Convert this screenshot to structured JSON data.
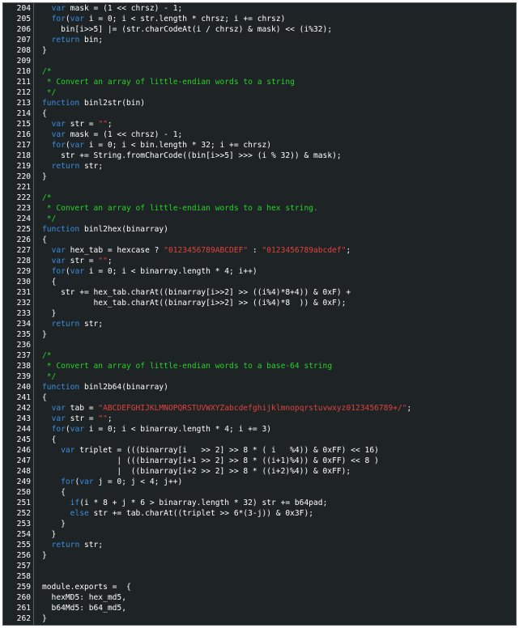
{
  "editor": {
    "theme_colors": {
      "background": "#1e2326",
      "text": "#ffffff",
      "keyword": "#3a8dde",
      "comment": "#27d227",
      "string": "#e0423c",
      "gutter_border": "#555d62"
    },
    "lines": [
      {
        "n": "204",
        "tokens": [
          {
            "t": "pl",
            "v": "  "
          },
          {
            "t": "kw",
            "v": "var"
          },
          {
            "t": "pl",
            "v": " mask = (1 << chrsz) - 1;"
          }
        ]
      },
      {
        "n": "205",
        "tokens": [
          {
            "t": "pl",
            "v": "  "
          },
          {
            "t": "kw",
            "v": "for"
          },
          {
            "t": "pl",
            "v": "("
          },
          {
            "t": "kw",
            "v": "var"
          },
          {
            "t": "pl",
            "v": " i = 0; i < str.length * chrsz; i += chrsz)"
          }
        ]
      },
      {
        "n": "206",
        "tokens": [
          {
            "t": "pl",
            "v": "    bin[i>>5] |= (str.charCodeAt(i / chrsz) & mask) << (i%32);"
          }
        ]
      },
      {
        "n": "207",
        "tokens": [
          {
            "t": "pl",
            "v": "  "
          },
          {
            "t": "kw",
            "v": "return"
          },
          {
            "t": "pl",
            "v": " bin;"
          }
        ]
      },
      {
        "n": "208",
        "tokens": [
          {
            "t": "pl",
            "v": "}"
          }
        ]
      },
      {
        "n": "209",
        "tokens": []
      },
      {
        "n": "210",
        "tokens": [
          {
            "t": "cm",
            "v": "/*"
          }
        ]
      },
      {
        "n": "211",
        "tokens": [
          {
            "t": "cm",
            "v": " * Convert an array of little-endian words to a string"
          }
        ]
      },
      {
        "n": "212",
        "tokens": [
          {
            "t": "cm",
            "v": " */"
          }
        ]
      },
      {
        "n": "213",
        "tokens": [
          {
            "t": "kw",
            "v": "function"
          },
          {
            "t": "pl",
            "v": " binl2str(bin)"
          }
        ]
      },
      {
        "n": "214",
        "tokens": [
          {
            "t": "pl",
            "v": "{"
          }
        ]
      },
      {
        "n": "215",
        "tokens": [
          {
            "t": "pl",
            "v": "  "
          },
          {
            "t": "kw",
            "v": "var"
          },
          {
            "t": "pl",
            "v": " str = "
          },
          {
            "t": "str",
            "v": "\"\""
          },
          {
            "t": "pl",
            "v": ";"
          }
        ]
      },
      {
        "n": "216",
        "tokens": [
          {
            "t": "pl",
            "v": "  "
          },
          {
            "t": "kw",
            "v": "var"
          },
          {
            "t": "pl",
            "v": " mask = (1 << chrsz) - 1;"
          }
        ]
      },
      {
        "n": "217",
        "tokens": [
          {
            "t": "pl",
            "v": "  "
          },
          {
            "t": "kw",
            "v": "for"
          },
          {
            "t": "pl",
            "v": "("
          },
          {
            "t": "kw",
            "v": "var"
          },
          {
            "t": "pl",
            "v": " i = 0; i < bin.length * 32; i += chrsz)"
          }
        ]
      },
      {
        "n": "218",
        "tokens": [
          {
            "t": "pl",
            "v": "    str += String.fromCharCode((bin[i>>5] >>> (i % 32)) & mask);"
          }
        ]
      },
      {
        "n": "219",
        "tokens": [
          {
            "t": "pl",
            "v": "  "
          },
          {
            "t": "kw",
            "v": "return"
          },
          {
            "t": "pl",
            "v": " str;"
          }
        ]
      },
      {
        "n": "220",
        "tokens": [
          {
            "t": "pl",
            "v": "}"
          }
        ]
      },
      {
        "n": "221",
        "tokens": []
      },
      {
        "n": "222",
        "tokens": [
          {
            "t": "cm",
            "v": "/*"
          }
        ]
      },
      {
        "n": "223",
        "tokens": [
          {
            "t": "cm",
            "v": " * Convert an array of little-endian words to a hex string."
          }
        ]
      },
      {
        "n": "224",
        "tokens": [
          {
            "t": "cm",
            "v": " */"
          }
        ]
      },
      {
        "n": "225",
        "tokens": [
          {
            "t": "kw",
            "v": "function"
          },
          {
            "t": "pl",
            "v": " binl2hex(binarray)"
          }
        ]
      },
      {
        "n": "226",
        "tokens": [
          {
            "t": "pl",
            "v": "{"
          }
        ]
      },
      {
        "n": "227",
        "tokens": [
          {
            "t": "pl",
            "v": "  "
          },
          {
            "t": "kw",
            "v": "var"
          },
          {
            "t": "pl",
            "v": " hex_tab = hexcase ? "
          },
          {
            "t": "str",
            "v": "\"0123456789ABCDEF\""
          },
          {
            "t": "pl",
            "v": " : "
          },
          {
            "t": "str",
            "v": "\"0123456789abcdef\""
          },
          {
            "t": "pl",
            "v": ";"
          }
        ]
      },
      {
        "n": "228",
        "tokens": [
          {
            "t": "pl",
            "v": "  "
          },
          {
            "t": "kw",
            "v": "var"
          },
          {
            "t": "pl",
            "v": " str = "
          },
          {
            "t": "str",
            "v": "\"\""
          },
          {
            "t": "pl",
            "v": ";"
          }
        ]
      },
      {
        "n": "229",
        "tokens": [
          {
            "t": "pl",
            "v": "  "
          },
          {
            "t": "kw",
            "v": "for"
          },
          {
            "t": "pl",
            "v": "("
          },
          {
            "t": "kw",
            "v": "var"
          },
          {
            "t": "pl",
            "v": " i = 0; i < binarray.length * 4; i++)"
          }
        ]
      },
      {
        "n": "230",
        "tokens": [
          {
            "t": "pl",
            "v": "  {"
          }
        ]
      },
      {
        "n": "231",
        "tokens": [
          {
            "t": "pl",
            "v": "    str += hex_tab.charAt((binarray[i>>2] >> ((i%4)*8+4)) & 0xF) +"
          }
        ]
      },
      {
        "n": "232",
        "tokens": [
          {
            "t": "pl",
            "v": "           hex_tab.charAt((binarray[i>>2] >> ((i%4)*8  )) & 0xF);"
          }
        ]
      },
      {
        "n": "233",
        "tokens": [
          {
            "t": "pl",
            "v": "  }"
          }
        ]
      },
      {
        "n": "234",
        "tokens": [
          {
            "t": "pl",
            "v": "  "
          },
          {
            "t": "kw",
            "v": "return"
          },
          {
            "t": "pl",
            "v": " str;"
          }
        ]
      },
      {
        "n": "235",
        "tokens": [
          {
            "t": "pl",
            "v": "}"
          }
        ]
      },
      {
        "n": "236",
        "tokens": []
      },
      {
        "n": "237",
        "tokens": [
          {
            "t": "cm",
            "v": "/*"
          }
        ]
      },
      {
        "n": "238",
        "tokens": [
          {
            "t": "cm",
            "v": " * Convert an array of little-endian words to a base-64 string"
          }
        ]
      },
      {
        "n": "239",
        "tokens": [
          {
            "t": "cm",
            "v": " */"
          }
        ]
      },
      {
        "n": "240",
        "tokens": [
          {
            "t": "kw",
            "v": "function"
          },
          {
            "t": "pl",
            "v": " binl2b64(binarray)"
          }
        ]
      },
      {
        "n": "241",
        "tokens": [
          {
            "t": "pl",
            "v": "{"
          }
        ]
      },
      {
        "n": "242",
        "tokens": [
          {
            "t": "pl",
            "v": "  "
          },
          {
            "t": "kw",
            "v": "var"
          },
          {
            "t": "pl",
            "v": " tab = "
          },
          {
            "t": "str",
            "v": "\"ABCDEFGHIJKLMNOPQRSTUVWXYZabcdefghijklmnopqrstuvwxyz0123456789+/\""
          },
          {
            "t": "pl",
            "v": ";"
          }
        ]
      },
      {
        "n": "243",
        "tokens": [
          {
            "t": "pl",
            "v": "  "
          },
          {
            "t": "kw",
            "v": "var"
          },
          {
            "t": "pl",
            "v": " str = "
          },
          {
            "t": "str",
            "v": "\"\""
          },
          {
            "t": "pl",
            "v": ";"
          }
        ]
      },
      {
        "n": "244",
        "tokens": [
          {
            "t": "pl",
            "v": "  "
          },
          {
            "t": "kw",
            "v": "for"
          },
          {
            "t": "pl",
            "v": "("
          },
          {
            "t": "kw",
            "v": "var"
          },
          {
            "t": "pl",
            "v": " i = 0; i < binarray.length * 4; i += 3)"
          }
        ]
      },
      {
        "n": "245",
        "tokens": [
          {
            "t": "pl",
            "v": "  {"
          }
        ]
      },
      {
        "n": "246",
        "tokens": [
          {
            "t": "pl",
            "v": "    "
          },
          {
            "t": "kw",
            "v": "var"
          },
          {
            "t": "pl",
            "v": " triplet = (((binarray[i   >> 2] >> 8 * ( i   %4)) & 0xFF) << 16)"
          }
        ]
      },
      {
        "n": "247",
        "tokens": [
          {
            "t": "pl",
            "v": "                | (((binarray[i+1 >> 2] >> 8 * ((i+1)%4)) & 0xFF) << 8 )"
          }
        ]
      },
      {
        "n": "248",
        "tokens": [
          {
            "t": "pl",
            "v": "                |  ((binarray[i+2 >> 2] >> 8 * ((i+2)%4)) & 0xFF);"
          }
        ]
      },
      {
        "n": "249",
        "tokens": [
          {
            "t": "pl",
            "v": "    "
          },
          {
            "t": "kw",
            "v": "for"
          },
          {
            "t": "pl",
            "v": "("
          },
          {
            "t": "kw",
            "v": "var"
          },
          {
            "t": "pl",
            "v": " j = 0; j < 4; j++)"
          }
        ]
      },
      {
        "n": "250",
        "tokens": [
          {
            "t": "pl",
            "v": "    {"
          }
        ]
      },
      {
        "n": "251",
        "tokens": [
          {
            "t": "pl",
            "v": "      "
          },
          {
            "t": "kw",
            "v": "if"
          },
          {
            "t": "pl",
            "v": "(i * 8 + j * 6 > binarray.length * 32) str += b64pad;"
          }
        ]
      },
      {
        "n": "252",
        "tokens": [
          {
            "t": "pl",
            "v": "      "
          },
          {
            "t": "kw",
            "v": "else"
          },
          {
            "t": "pl",
            "v": " str += tab.charAt((triplet >> 6*(3-j)) & 0x3F);"
          }
        ]
      },
      {
        "n": "253",
        "tokens": [
          {
            "t": "pl",
            "v": "    }"
          }
        ]
      },
      {
        "n": "254",
        "tokens": [
          {
            "t": "pl",
            "v": "  }"
          }
        ]
      },
      {
        "n": "255",
        "tokens": [
          {
            "t": "pl",
            "v": "  "
          },
          {
            "t": "kw",
            "v": "return"
          },
          {
            "t": "pl",
            "v": " str;"
          }
        ]
      },
      {
        "n": "256",
        "tokens": [
          {
            "t": "pl",
            "v": "}"
          }
        ]
      },
      {
        "n": "257",
        "tokens": []
      },
      {
        "n": "258",
        "tokens": []
      },
      {
        "n": "259",
        "tokens": [
          {
            "t": "pl",
            "v": "module.exports =  {"
          }
        ]
      },
      {
        "n": "260",
        "tokens": [
          {
            "t": "pl",
            "v": "  hexMD5: hex_md5,"
          }
        ]
      },
      {
        "n": "261",
        "tokens": [
          {
            "t": "pl",
            "v": "  b64Md5: b64_md5,"
          }
        ]
      },
      {
        "n": "262",
        "tokens": [
          {
            "t": "pl",
            "v": "}"
          }
        ]
      }
    ]
  }
}
